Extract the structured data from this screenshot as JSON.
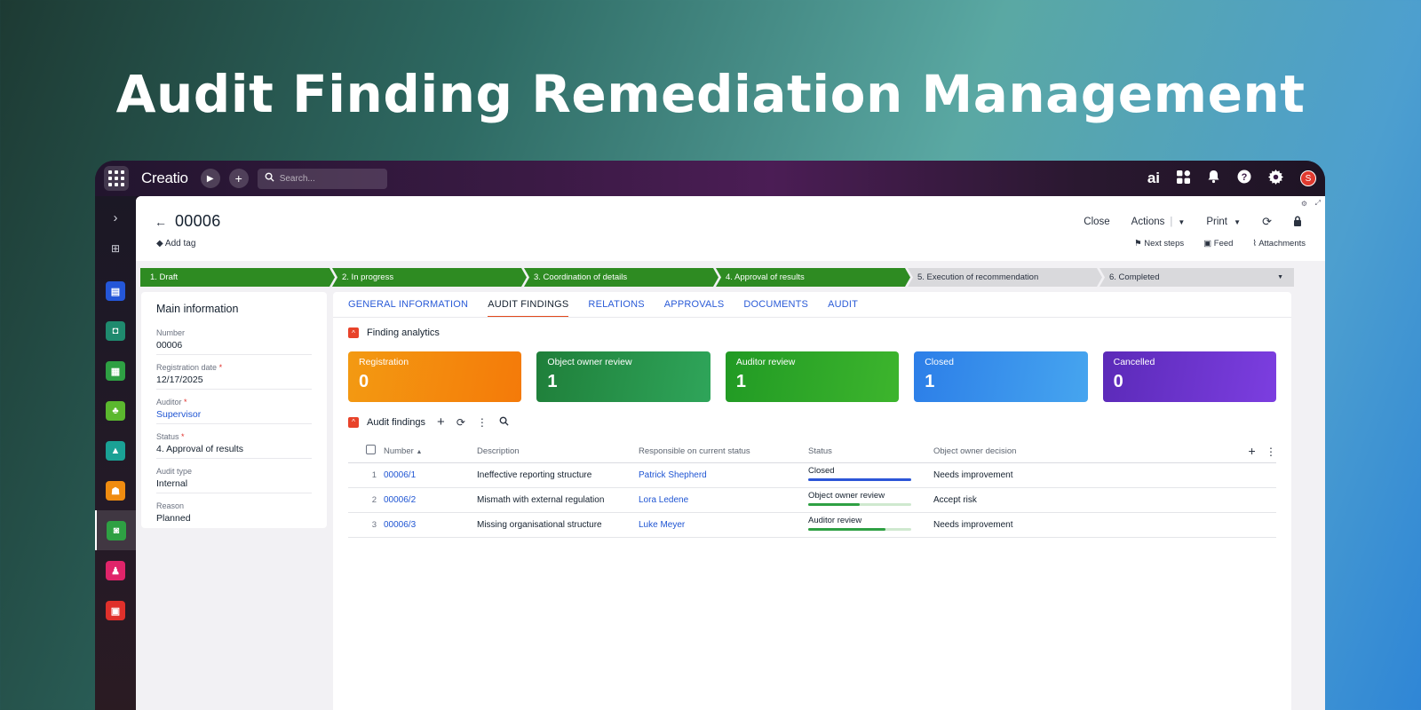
{
  "hero_title": "Audit Finding Remediation Management",
  "topbar": {
    "logo": "Creatio",
    "search_placeholder": "Search...",
    "ai_label": "ai",
    "avatar_initial": "S"
  },
  "record": {
    "title": "00006",
    "add_tag": "Add tag",
    "actions": [
      "Close",
      "Actions",
      "Print"
    ],
    "links": [
      "Next steps",
      "Feed",
      "Attachments"
    ]
  },
  "stages": [
    {
      "label": "1. Draft",
      "state": "done"
    },
    {
      "label": "2. In progress",
      "state": "done"
    },
    {
      "label": "3. Coordination of details",
      "state": "done"
    },
    {
      "label": "4. Approval of results",
      "state": "done"
    },
    {
      "label": "5. Execution of recommendation",
      "state": "todo"
    },
    {
      "label": "6. Completed",
      "state": "todo"
    }
  ],
  "main_info": {
    "title": "Main information",
    "fields": [
      {
        "label": "Number",
        "value": "00006",
        "required": false,
        "link": false
      },
      {
        "label": "Registration date",
        "value": "12/17/2025",
        "required": true,
        "link": false
      },
      {
        "label": "Auditor",
        "value": "Supervisor",
        "required": true,
        "link": true
      },
      {
        "label": "Status",
        "value": "4. Approval of results",
        "required": true,
        "link": false
      },
      {
        "label": "Audit type",
        "value": "Internal",
        "required": false,
        "link": false
      },
      {
        "label": "Reason",
        "value": "Planned",
        "required": false,
        "link": false
      }
    ]
  },
  "tabs": [
    "GENERAL INFORMATION",
    "AUDIT FINDINGS",
    "RELATIONS",
    "APPROVALS",
    "DOCUMENTS",
    "AUDIT"
  ],
  "active_tab": "AUDIT FINDINGS",
  "analytics": {
    "title": "Finding analytics",
    "cards": [
      {
        "label": "Registration",
        "value": "0",
        "color": "#f47a09"
      },
      {
        "label": "Object owner review",
        "value": "1",
        "color": "#2fa55a"
      },
      {
        "label": "Auditor review",
        "value": "1",
        "color": "#3db52d"
      },
      {
        "label": "Closed",
        "value": "1",
        "color": "#2c7ee8"
      },
      {
        "label": "Cancelled",
        "value": "0",
        "color": "#7c3ee0"
      }
    ]
  },
  "findings": {
    "title": "Audit findings",
    "columns": [
      "Number",
      "Description",
      "Responsible on current status",
      "Status",
      "Object owner decision"
    ],
    "rows": [
      {
        "idx": "1",
        "number": "00006/1",
        "description": "Ineffective reporting structure",
        "responsible": "Patrick Shepherd",
        "status": "Closed",
        "progress": 1.0,
        "bar_color": "#2c56d8",
        "decision": "Needs improvement"
      },
      {
        "idx": "2",
        "number": "00006/2",
        "description": "Mismath with external regulation",
        "responsible": "Lora Ledene",
        "status": "Object owner review",
        "progress": 0.5,
        "bar_color": "#2ea043",
        "decision": "Accept risk"
      },
      {
        "idx": "3",
        "number": "00006/3",
        "description": "Missing organisational structure",
        "responsible": "Luke Meyer",
        "status": "Auditor review",
        "progress": 0.75,
        "bar_color": "#2ea043",
        "decision": "Needs improvement"
      }
    ]
  }
}
